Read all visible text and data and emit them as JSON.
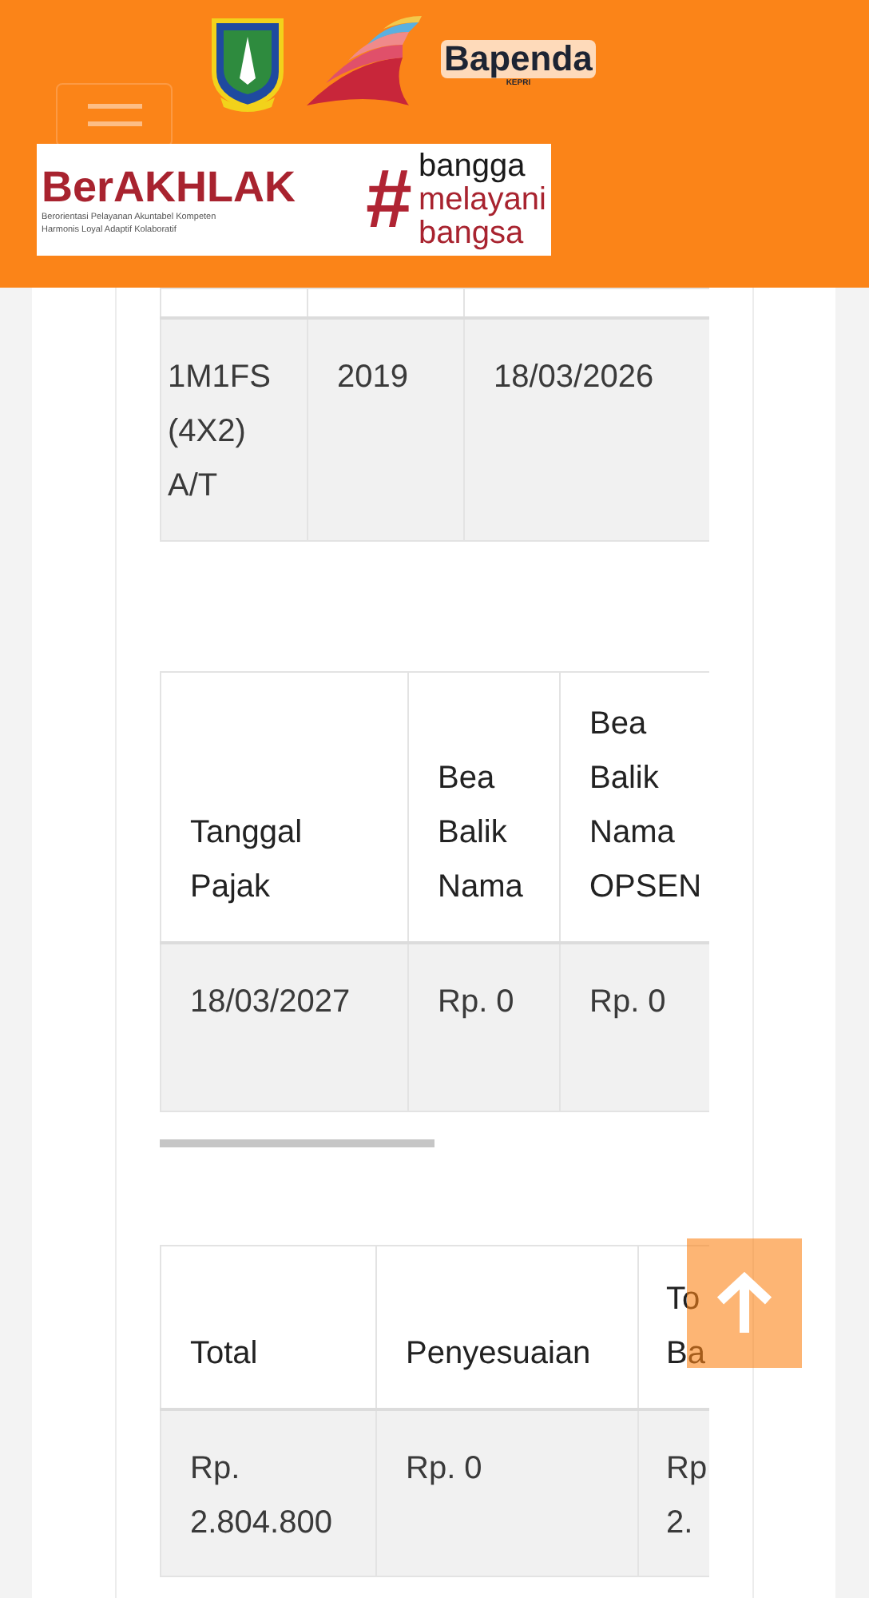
{
  "header": {
    "logo_text": "Bapenda",
    "logo_subtext": "KEPRI",
    "banner": {
      "title": "BerAKHLAK",
      "tagline_lines": [
        "Berorientasi Pelayanan Akuntabel Kompeten",
        "Harmonis Loyal Adaptif Kolaboratif"
      ],
      "hashtag": "#",
      "slogan": [
        "bangga",
        "melayani",
        "bangsa"
      ]
    }
  },
  "tables": [
    {
      "rows": [
        [
          "1M1FS (4X2) A/T",
          "2019",
          "18/03/2026"
        ]
      ]
    },
    {
      "columns": [
        "Tanggal Pajak",
        "Bea Balik Nama",
        "Bea Balik Nama OPSEN"
      ],
      "rows": [
        [
          "18/03/2027",
          "Rp. 0",
          "Rp. 0"
        ]
      ]
    },
    {
      "columns": [
        "Total",
        "Penyesuaian",
        "To Ba"
      ],
      "rows": [
        [
          "Rp. 2.804.800",
          "Rp. 0",
          "Rp 2."
        ]
      ]
    }
  ]
}
